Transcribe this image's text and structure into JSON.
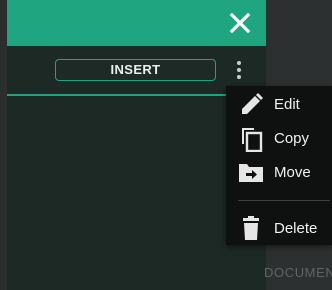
{
  "header": {
    "close_icon": "close-icon",
    "accent_color": "#1fa57f"
  },
  "toolbar": {
    "insert_label": "INSERT",
    "more_icon": "more-vertical-icon"
  },
  "context_menu": {
    "items": [
      {
        "label": "Edit",
        "icon": "pencil-icon"
      },
      {
        "label": "Copy",
        "icon": "copy-icon"
      },
      {
        "label": "Move",
        "icon": "move-folder-icon"
      },
      {
        "label": "Delete",
        "icon": "trash-icon"
      }
    ]
  },
  "background": {
    "partial_text": "DOCUMEN"
  }
}
